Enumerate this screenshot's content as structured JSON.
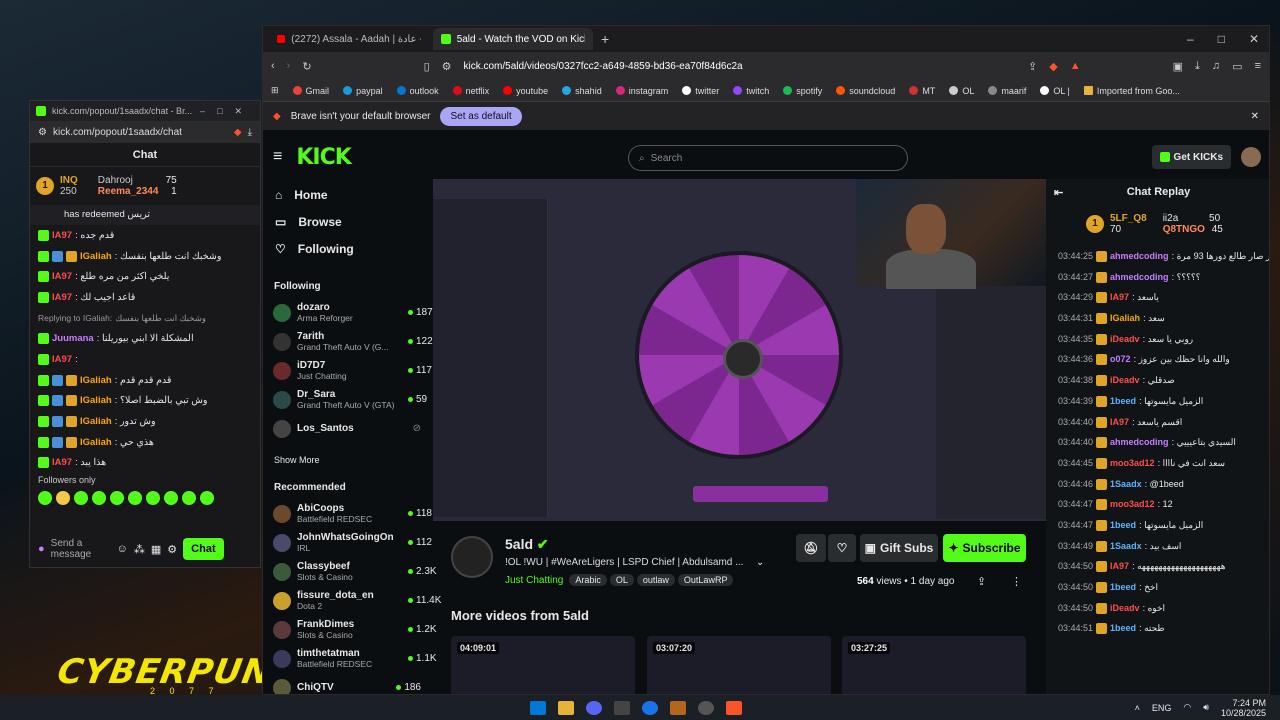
{
  "desktop": {
    "logo": "CYBERPUNK",
    "logo_sub": "2 0 7 7"
  },
  "popout": {
    "title": "kick.com/popout/1saadx/chat - Br...",
    "url": "kick.com/popout/1saadx/chat",
    "header": "Chat",
    "leaders": [
      {
        "name": "INQ",
        "value": "250"
      },
      {
        "name": "Dahrooj",
        "value": "75"
      },
      {
        "name": "Reema_2344",
        "value": "1"
      }
    ],
    "redeem": "has redeemed تريس",
    "messages": [
      {
        "user": "IA97",
        "text": ": قدم جده",
        "color": "ur"
      },
      {
        "user": "IGaliah",
        "text": ": وشخبك انت طلعها بنفسك",
        "color": "uy"
      },
      {
        "user": "IA97",
        "text": ": يلخي اكثر من مره طلع",
        "color": "ur"
      },
      {
        "user": "IA97",
        "text": ": قاعد اجيب لك",
        "color": "ur"
      },
      {
        "user": "Replying to IGaliah:",
        "text": "وشخبك انت طلعها بنفسك",
        "color": "grey"
      },
      {
        "user": "Juumana",
        "text": ": المشكلة الا ابني بيوريلنا",
        "color": "up"
      },
      {
        "user": "IA97",
        "text": ":",
        "color": "ur"
      },
      {
        "user": "IGaliah",
        "text": ": قدم قدم قدم",
        "color": "uy"
      },
      {
        "user": "IGaliah",
        "text": ": وش تبي بالضبط اصلا؟",
        "color": "uy"
      },
      {
        "user": "IGaliah",
        "text": ": وش تدور",
        "color": "uy"
      },
      {
        "user": "IGaliah",
        "text": ": هذي حي",
        "color": "uy"
      },
      {
        "user": "IA97",
        "text": ": هذا يبد",
        "color": "ur"
      }
    ],
    "followers_only": "Followers only",
    "send_placeholder": "Send a message",
    "chat_button": "Chat"
  },
  "browser": {
    "tabs": [
      {
        "label": "(2272) Assala - Aadah | أصالة - عادة"
      },
      {
        "label": "5ald - Watch the VOD on Kick"
      }
    ],
    "url": "kick.com/5ald/videos/0327fcc2-a649-4859-bd36-ea70f84d6c2a",
    "bookmarks": [
      "Gmail",
      "paypal",
      "outlook",
      "netflix",
      "youtube",
      "shahid",
      "instagram",
      "twitter",
      "twitch",
      "spotify",
      "soundcloud",
      "MT",
      "OL",
      "maarif",
      "OL |",
      "Imported from Goo..."
    ],
    "info_text": "Brave isn't your default browser",
    "set_default": "Set as default"
  },
  "kick": {
    "logo": "KICK",
    "search_placeholder": "Search",
    "get_kicks": "Get KICKs",
    "nav": [
      "Home",
      "Browse",
      "Following"
    ],
    "following_label": "Following",
    "following": [
      {
        "name": "dozaro",
        "game": "Arma Reforger",
        "viewers": "187",
        "color": "#2a6a3a"
      },
      {
        "name": "7arith",
        "game": "Grand Theft Auto V (G...",
        "viewers": "122",
        "color": "#333"
      },
      {
        "name": "iD7D7",
        "game": "Just Chatting",
        "viewers": "117",
        "color": "#6a2a2a"
      },
      {
        "name": "Dr_Sara",
        "game": "Grand Theft Auto V (GTA)",
        "viewers": "59",
        "color": "#2a4a4a"
      },
      {
        "name": "Los_Santos",
        "game": "",
        "viewers": "",
        "color": "#444"
      }
    ],
    "show_more": "Show More",
    "recommended_label": "Recommended",
    "recommended": [
      {
        "name": "AbiCoops",
        "game": "Battlefield REDSEC",
        "viewers": "118",
        "color": "#6a4a2a"
      },
      {
        "name": "JohnWhatsGoingOn",
        "game": "IRL",
        "viewers": "112",
        "color": "#4a4a6a"
      },
      {
        "name": "Classybeef",
        "game": "Slots & Casino",
        "viewers": "2.3K",
        "color": "#3a5a3a"
      },
      {
        "name": "fissure_dota_en",
        "game": "Dota 2",
        "viewers": "11.4K",
        "color": "#c8a02a"
      },
      {
        "name": "FrankDimes",
        "game": "Slots & Casino",
        "viewers": "1.2K",
        "color": "#5a3a3a"
      },
      {
        "name": "timthetatman",
        "game": "Battlefield REDSEC",
        "viewers": "1.1K",
        "color": "#3a3a5a"
      },
      {
        "name": "ChiQTV",
        "game": "",
        "viewers": "186",
        "color": "#5a5a3a"
      }
    ],
    "channel": {
      "name": "5ald",
      "title": "!OL !WU | #WeAreLigers | LSPD Chief | Abdulsamd ...",
      "category": "Just Chatting",
      "tags": [
        "Arabic",
        "OL",
        "outlaw",
        "OutLawRP"
      ],
      "views": "564",
      "views_label": "views",
      "ago": "1 day ago"
    },
    "gift_subs": "Gift Subs",
    "subscribe": "Subscribe",
    "more_videos": "More videos from 5ald",
    "thumbs": [
      "04:09:01",
      "03:07:20",
      "03:27:25"
    ]
  },
  "replay": {
    "title": "Chat Replay",
    "leaders": [
      {
        "name": "5LF_Q8",
        "value": "70"
      },
      {
        "name": "ii2a",
        "value": "50"
      },
      {
        "name": "Q8TNGO",
        "value": "45"
      }
    ],
    "messages": [
      {
        "t": "03:44:25",
        "u": "ahmedcoding",
        "m": ": عيبر صار طالع دورها 93 مرة",
        "c": "up"
      },
      {
        "t": "03:44:27",
        "u": "ahmedcoding",
        "m": ": ؟؟؟؟؟",
        "c": "up"
      },
      {
        "t": "03:44:29",
        "u": "IA97",
        "m": ": ياسعد",
        "c": "ur"
      },
      {
        "t": "03:44:31",
        "u": "IGaliah",
        "m": ": سعد",
        "c": "uy"
      },
      {
        "t": "03:44:35",
        "u": "iDeadv",
        "m": ": روبي يا سعد",
        "c": "ur"
      },
      {
        "t": "03:44:36",
        "u": "o072",
        "m": ": والله وانا حظك بين عزوز",
        "c": "up"
      },
      {
        "t": "03:44:38",
        "u": "iDeadv",
        "m": ": صدقلي",
        "c": "ur"
      },
      {
        "t": "03:44:39",
        "u": "1beed",
        "m": ": الزميل مايسوتها",
        "c": "ub"
      },
      {
        "t": "03:44:40",
        "u": "IA97",
        "m": ": اقسم ياسعد",
        "c": "ur"
      },
      {
        "t": "03:44:40",
        "u": "ahmedcoding",
        "m": ": السيدي بتاعيييي",
        "c": "up"
      },
      {
        "t": "03:44:45",
        "u": "moo3ad12",
        "m": ": سعد انت في ناااا",
        "c": "ur"
      },
      {
        "t": "03:44:46",
        "u": "1Saadx",
        "m": ": @1beed",
        "c": "ub"
      },
      {
        "t": "03:44:47",
        "u": "moo3ad12",
        "m": ": 12",
        "c": "ur"
      },
      {
        "t": "03:44:47",
        "u": "1beed",
        "m": ": الزميل مايسوتها",
        "c": "ub"
      },
      {
        "t": "03:44:49",
        "u": "1Saadx",
        "m": ": اسف بيد",
        "c": "ub"
      },
      {
        "t": "03:44:50",
        "u": "IA97",
        "m": ": ههههههههههههههههههههه",
        "c": "ur"
      },
      {
        "t": "03:44:50",
        "u": "1beed",
        "m": ": اخخ",
        "c": "ub"
      },
      {
        "t": "03:44:50",
        "u": "iDeadv",
        "m": ": اخوه",
        "c": "ur"
      },
      {
        "t": "03:44:51",
        "u": "1beed",
        "m": ": طحته",
        "c": "ub"
      }
    ]
  },
  "taskbar": {
    "lang": "ENG",
    "time": "7:24 PM",
    "date": "10/28/2025"
  }
}
